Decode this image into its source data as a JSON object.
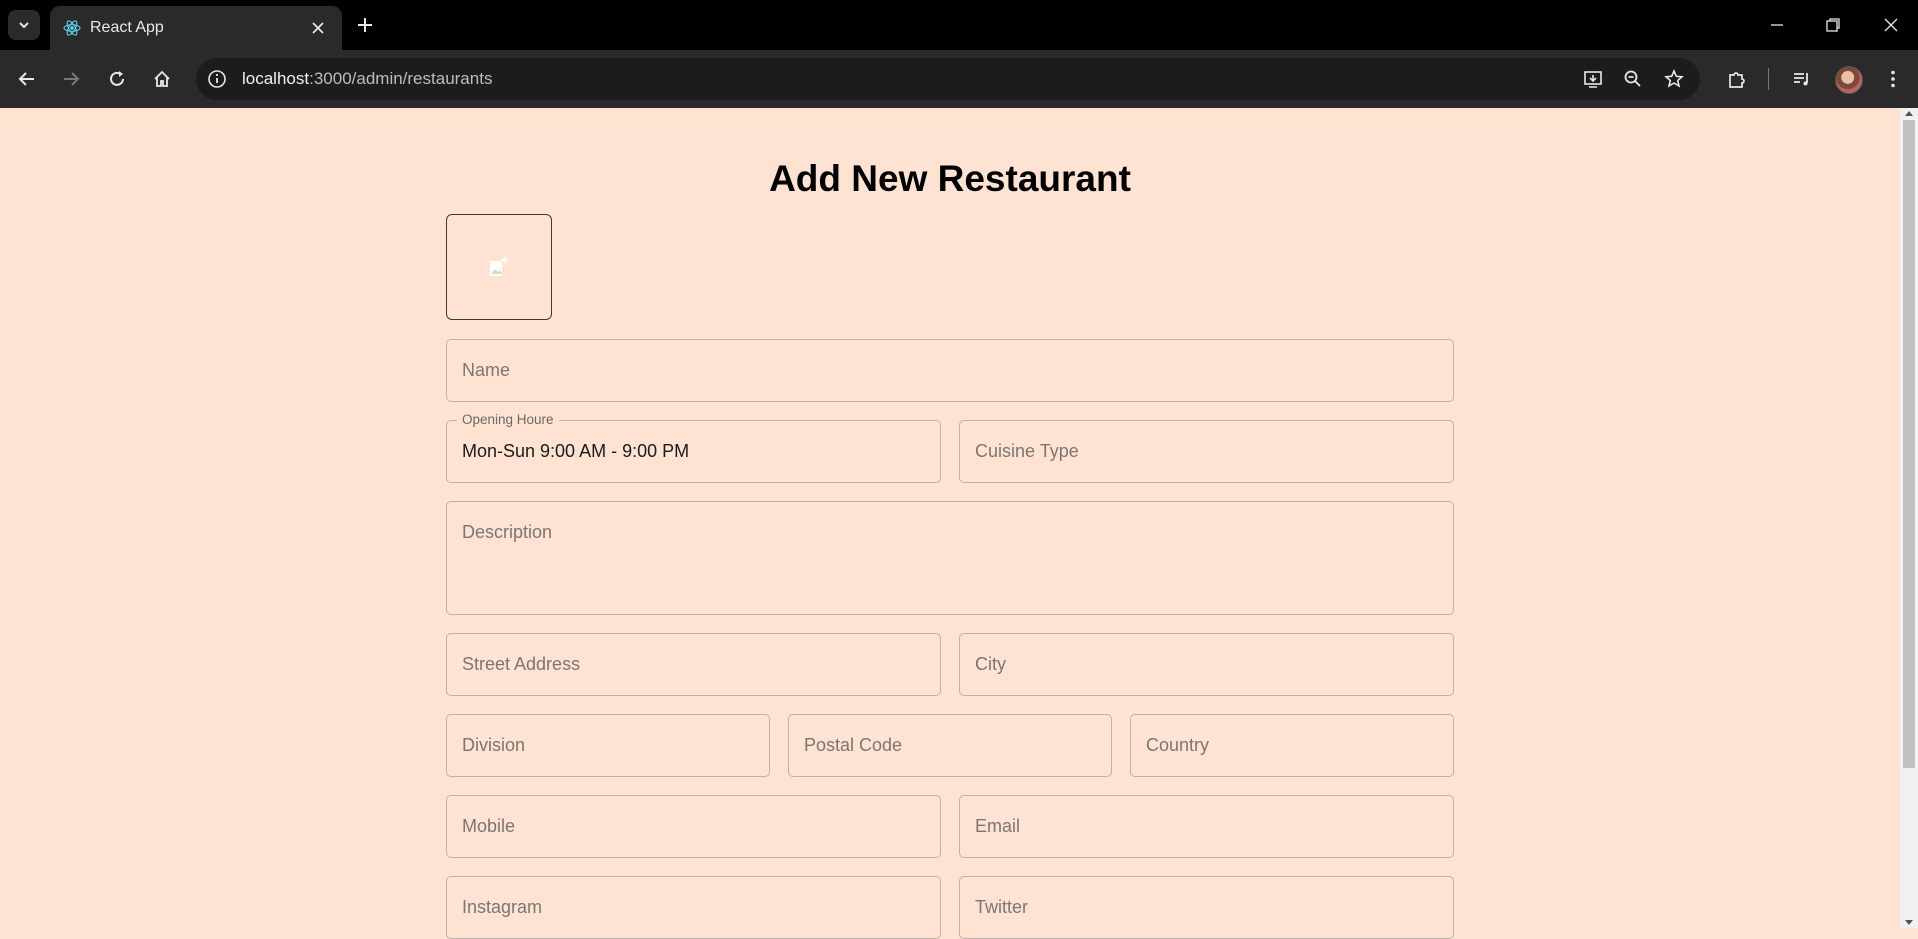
{
  "browser": {
    "tab_title": "React App",
    "url_host": "localhost",
    "url_path": ":3000/admin/restaurants"
  },
  "icons": {
    "tab_search": "chevron-down-icon",
    "favicon": "react-icon",
    "tab_close": "close-icon",
    "new_tab": "plus-icon",
    "back": "arrow-left-icon",
    "forward": "arrow-right-icon",
    "reload": "reload-icon",
    "home": "home-icon",
    "site_info": "info-icon",
    "install": "install-app-icon",
    "zoom": "zoom-icon",
    "bookmark": "star-icon",
    "extensions": "puzzle-icon",
    "media": "media-icon",
    "menu": "kebab-menu-icon",
    "upload": "add-photo-icon"
  },
  "form": {
    "title": "Add New Restaurant",
    "name": {
      "placeholder": "Name",
      "value": ""
    },
    "opening_hours": {
      "label": "Opening Houre",
      "value": "Mon-Sun 9:00 AM - 9:00 PM"
    },
    "cuisine_type": {
      "placeholder": "Cuisine Type",
      "value": ""
    },
    "description": {
      "placeholder": "Description",
      "value": ""
    },
    "street_address": {
      "placeholder": "Street Address",
      "value": ""
    },
    "city": {
      "placeholder": "City",
      "value": ""
    },
    "division": {
      "placeholder": "Division",
      "value": ""
    },
    "postal_code": {
      "placeholder": "Postal Code",
      "value": ""
    },
    "country": {
      "placeholder": "Country",
      "value": ""
    },
    "mobile": {
      "placeholder": "Mobile",
      "value": ""
    },
    "email": {
      "placeholder": "Email",
      "value": ""
    },
    "instagram": {
      "placeholder": "Instagram",
      "value": ""
    },
    "twitter": {
      "placeholder": "Twitter",
      "value": ""
    }
  },
  "colors": {
    "page_background": "#fee3d3",
    "field_border": "#bcb2ac",
    "chrome_background": "#000000"
  }
}
